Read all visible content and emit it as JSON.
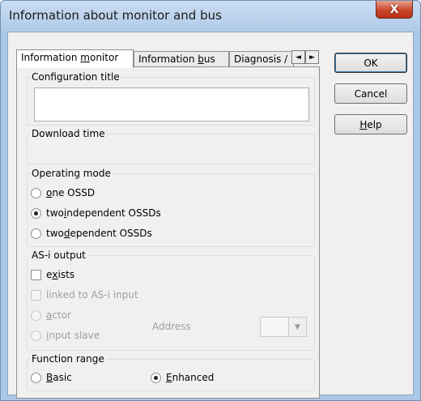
{
  "window": {
    "title": "Information about monitor and bus",
    "close_label": "X"
  },
  "tabs": [
    {
      "label_pre": "Information ",
      "label_accel": "m",
      "label_post": "onitor",
      "active": true
    },
    {
      "label_pre": "Information ",
      "label_accel": "b",
      "label_post": "us",
      "active": false
    },
    {
      "label_pre": "Diagnosis / S",
      "label_accel": "",
      "label_post": "",
      "active": false
    }
  ],
  "tab_scroll": {
    "left": "◄",
    "right": "►"
  },
  "config_title": {
    "label": "Configuration title",
    "value": ""
  },
  "download_time": {
    "label": "Download time",
    "value": ""
  },
  "operating_mode": {
    "label": "Operating mode",
    "options": [
      {
        "pre": "",
        "accel": "o",
        "post": "ne OSSD",
        "selected": false
      },
      {
        "pre": "two ",
        "accel": "i",
        "post": "ndependent OSSDs",
        "selected": true
      },
      {
        "pre": "two ",
        "accel": "d",
        "post": "ependent OSSDs",
        "selected": false
      }
    ]
  },
  "asi_output": {
    "label": "AS-i output",
    "exists": {
      "pre": "e",
      "accel": "x",
      "post": "ists",
      "checked": false
    },
    "linked": {
      "label": "linked to AS-i input",
      "checked": false
    },
    "actor": {
      "pre": "",
      "accel": "a",
      "post": "ctor",
      "selected": false
    },
    "input_slave": {
      "pre": "",
      "accel": "i",
      "post": "nput slave",
      "selected": false
    },
    "address_label": "Address",
    "address_value": "",
    "combo_arrow": "▼"
  },
  "function_range": {
    "label": "Function range",
    "basic": {
      "pre": "",
      "accel": "B",
      "post": "asic",
      "selected": false
    },
    "enhanced": {
      "pre": "",
      "accel": "E",
      "post": "nhanced",
      "selected": true
    }
  },
  "buttons": {
    "ok": "OK",
    "cancel": "Cancel",
    "help_accel": "H",
    "help_post": "elp"
  }
}
